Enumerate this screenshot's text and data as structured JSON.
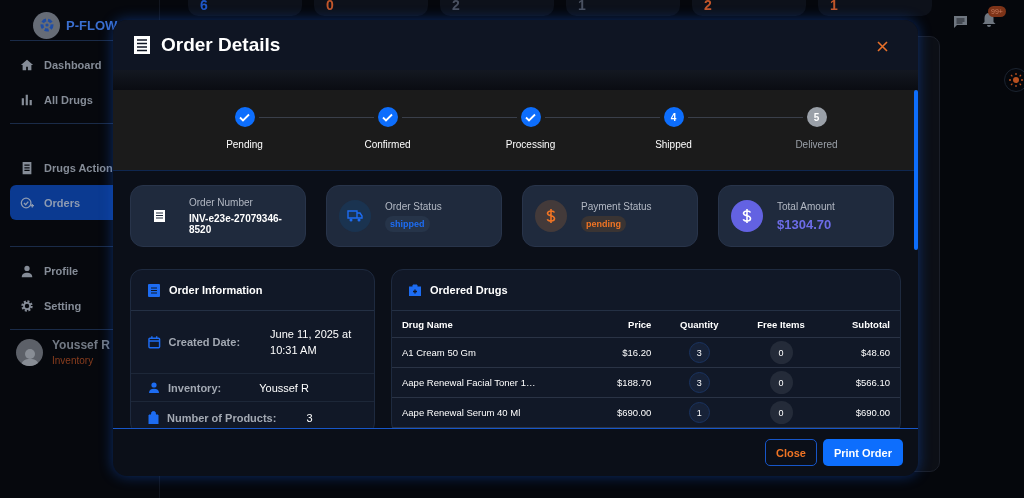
{
  "app": {
    "name": "P-FLOW"
  },
  "stats": [
    {
      "value": "6",
      "color": "#1f57c8"
    },
    {
      "value": "0",
      "color": "#c2562a"
    },
    {
      "value": "2",
      "color": "#4a5160"
    },
    {
      "value": "1",
      "color": "#4a5160"
    },
    {
      "value": "2",
      "color": "#c2562a"
    },
    {
      "value": "1",
      "color": "#c2562a"
    }
  ],
  "topbar": {
    "notification_count": "99+"
  },
  "sidebar": {
    "sections": [
      [
        {
          "label": "Dashboard",
          "kind": "home",
          "selected": false
        },
        {
          "label": "All Drugs",
          "kind": "chart",
          "selected": false
        }
      ],
      [
        {
          "label": "Drugs Action",
          "kind": "doc",
          "selected": false
        },
        {
          "label": "Orders",
          "kind": "orders",
          "selected": true
        }
      ],
      [
        {
          "label": "Profile",
          "kind": "person",
          "selected": false
        },
        {
          "label": "Setting",
          "kind": "gear",
          "selected": false
        }
      ]
    ],
    "user": {
      "name": "Youssef R",
      "role": "Inventory"
    }
  },
  "modal": {
    "title": "Order Details",
    "steps": [
      {
        "label": "Pending",
        "done": true
      },
      {
        "label": "Confirmed",
        "done": true
      },
      {
        "label": "Processing",
        "done": true
      },
      {
        "label": "Shipped",
        "done": false,
        "selected": true,
        "number": "4"
      },
      {
        "label": "Delivered",
        "done": false,
        "selected": false,
        "number": "5"
      }
    ],
    "summary": [
      {
        "kind": "number",
        "label": "Order Number",
        "value": "INV-e23e-27079346-8520"
      },
      {
        "kind": "shipping",
        "label": "Order Status",
        "badge": "shipped",
        "color": "#1d6cf2"
      },
      {
        "kind": "payment",
        "label": "Payment Status",
        "badge": "pending",
        "color": "#f07424"
      },
      {
        "kind": "amount",
        "label": "Total Amount",
        "value": "$1304.70"
      }
    ],
    "order_info": {
      "title": "Order Information",
      "rows": [
        {
          "kind": "date",
          "label": "Created Date:",
          "value": "June 11, 2025 at 10:31 AM"
        },
        {
          "kind": "user",
          "label": "Inventory:",
          "value": "Youssef R"
        },
        {
          "kind": "products",
          "label": "Number of Products:",
          "value": "3"
        }
      ]
    },
    "drugs": {
      "title": "Ordered Drugs",
      "columns": [
        "Drug Name",
        "Price",
        "Quantity",
        "Free Items",
        "Subtotal"
      ],
      "rows": [
        {
          "name": "A1 Cream 50 Gm",
          "price": "$16.20",
          "quantity": "3",
          "free_items": "0",
          "subtotal": "$48.60"
        },
        {
          "name": "Aape Renewal Facial Toner 1…",
          "price": "$188.70",
          "quantity": "3",
          "free_items": "0",
          "subtotal": "$566.10"
        },
        {
          "name": "Aape Renewal Serum 40 Ml",
          "price": "$690.00",
          "quantity": "1",
          "free_items": "0",
          "subtotal": "$690.00"
        }
      ]
    },
    "buttons": [
      {
        "label": "Close",
        "kind": "secondary"
      },
      {
        "label": "Print Order",
        "kind": "primary"
      }
    ]
  }
}
